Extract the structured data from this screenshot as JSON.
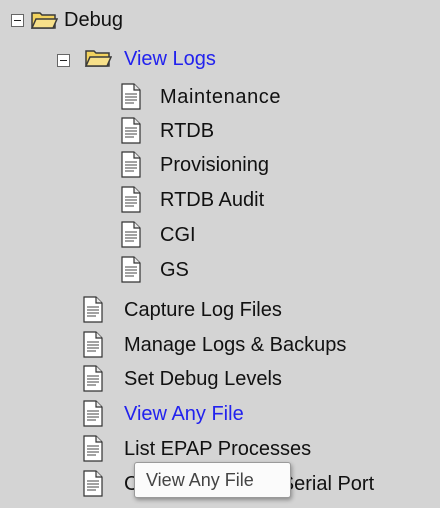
{
  "tree": {
    "root": {
      "label": "Debug",
      "icon": "folder-open-icon",
      "toggle": "minus",
      "children": {
        "view_logs": {
          "label": "View Logs",
          "icon": "folder-open-icon",
          "toggle": "minus",
          "items": [
            "Maintenance",
            "RTDB",
            "Provisioning",
            "RTDB Audit",
            "CGI",
            "GS"
          ]
        },
        "items": [
          "Capture Log Files",
          "Manage Logs & Backups",
          "Set Debug Levels",
          "View Any File",
          "List EPAP Processes",
          "Configure Debug Serial Port"
        ]
      }
    }
  },
  "tooltip": {
    "text": "View Any File"
  },
  "colors": {
    "tree_background": "#d4d4d4",
    "link_text": "#2222ee",
    "folder_fill": "#f3d35e",
    "folder_outline": "#3a3a3a"
  }
}
